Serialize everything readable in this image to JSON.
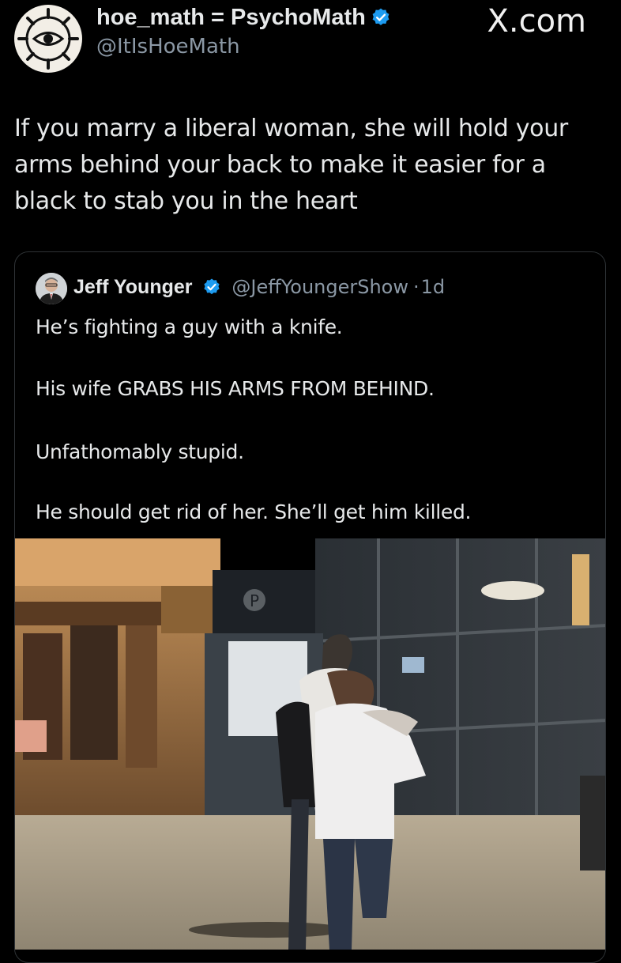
{
  "author": {
    "display_name": "hoe_math = PsychoMath",
    "handle": "@ItIsHoeMath",
    "avatar_icon": "eye-wheel-logo",
    "verified": true
  },
  "watermark": "X.com",
  "tweet": {
    "lines": [
      "If you marry a liberal woman, she will hold your",
      "arms behind your back to make it easier for a",
      "black to stab you in the heart"
    ]
  },
  "quoted_tweet": {
    "display_name": "Jeff Younger",
    "handle": "@JeffYoungerShow",
    "separator": "·",
    "time": "1d",
    "verified": true,
    "paragraphs": [
      "He’s fighting a guy with a knife.",
      "His wife GRABS HIS ARMS FROM BEHIND.",
      "Unfathomably stupid.",
      "He should get rid of her. She’ll get him killed."
    ],
    "media": {
      "parking_sign": "P"
    }
  },
  "colors": {
    "background": "#000000",
    "text": "#e7e9ea",
    "muted": "#8b98a5",
    "verified": "#1d9bf0",
    "border": "#2f3336"
  }
}
